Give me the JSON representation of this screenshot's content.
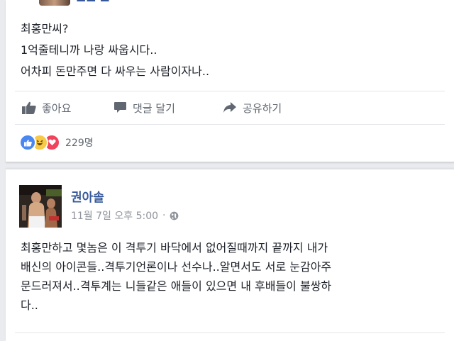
{
  "post1": {
    "lines": [
      "최홍만씨?",
      "1억줄테니까 나랑 싸웁시다..",
      "어차피 돈만주면 다 싸우는 사람이자나.."
    ],
    "actions": {
      "like": "좋아요",
      "comment": "댓글 달기",
      "share": "공유하기"
    },
    "reactions": {
      "icons": [
        "like-icon",
        "haha-icon",
        "love-icon"
      ],
      "count": "229명"
    }
  },
  "post2": {
    "author": "권아솔",
    "timestamp": "11월 7일 오후 5:00",
    "separator": "·",
    "privacy_icon": "globe-icon",
    "lines": [
      "최홍만하고 몇놈은 이 격투기 바닥에서 없어질때까지 끝까지 내가",
      "배신의 아이콘들..격투기언론이나 선수나..알면서도 서로 눈감아주",
      "문드러져서..격투계는 니들같은 애들이 있으면 내 후배들이 불쌍하",
      "다.."
    ]
  },
  "colors": {
    "link": "#365899",
    "meta": "#90949c",
    "action": "#606770",
    "background": "#e9ebee",
    "like_reaction": "#4a87f0",
    "haha_reaction": "#f7c948",
    "love_reaction": "#f0435c"
  }
}
